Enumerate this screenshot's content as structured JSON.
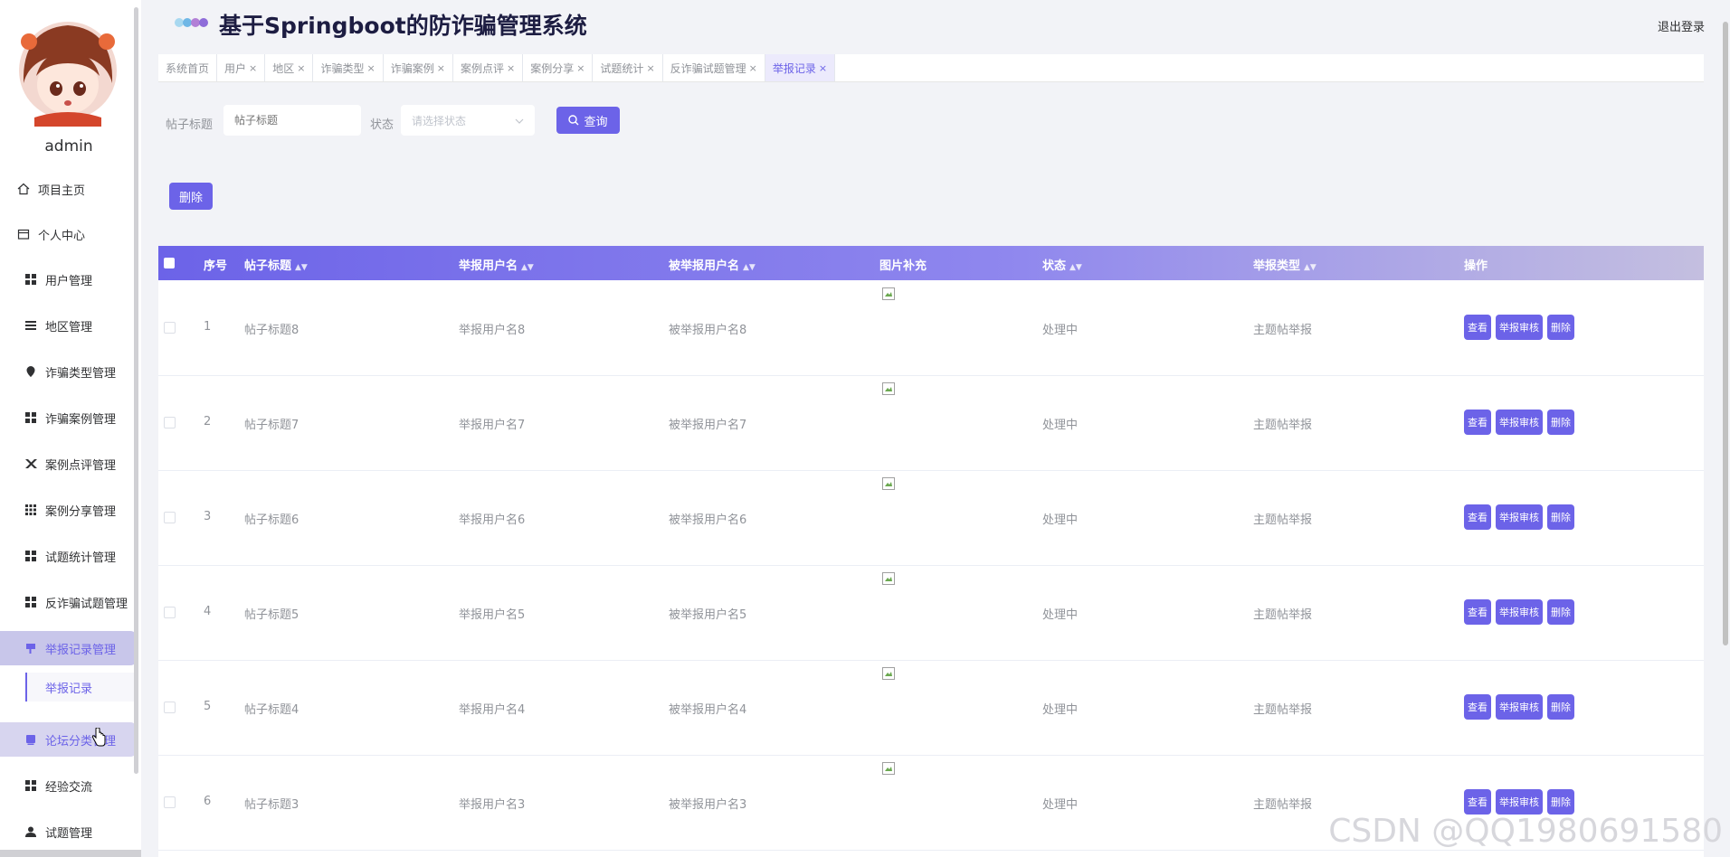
{
  "app": {
    "title": "基于Springboot的防诈骗管理系统",
    "logout": "退出登录"
  },
  "user": {
    "name": "admin"
  },
  "sidebar": {
    "items": [
      {
        "label": "项目主页",
        "icon": "home-icon"
      },
      {
        "label": "个人中心",
        "icon": "profile-icon"
      },
      {
        "label": "用户管理",
        "icon": "grid-icon"
      },
      {
        "label": "地区管理",
        "icon": "list-icon"
      },
      {
        "label": "诈骗类型管理",
        "icon": "pin-icon"
      },
      {
        "label": "诈骗案例管理",
        "icon": "grid-icon"
      },
      {
        "label": "案例点评管理",
        "icon": "swords-icon"
      },
      {
        "label": "案例分享管理",
        "icon": "grid9-icon"
      },
      {
        "label": "试题统计管理",
        "icon": "grid-icon"
      },
      {
        "label": "反诈骗试题管理",
        "icon": "grid-icon"
      },
      {
        "label": "举报记录管理",
        "icon": "flag-icon"
      },
      {
        "label": "论坛分类管理",
        "icon": "folder-icon"
      },
      {
        "label": "经验交流",
        "icon": "grid-icon"
      },
      {
        "label": "试题管理",
        "icon": "user-icon"
      }
    ],
    "sub_item": "举报记录"
  },
  "tabs": [
    {
      "label": "系统首页",
      "closable": false
    },
    {
      "label": "用户",
      "closable": true
    },
    {
      "label": "地区",
      "closable": true
    },
    {
      "label": "诈骗类型",
      "closable": true
    },
    {
      "label": "诈骗案例",
      "closable": true
    },
    {
      "label": "案例点评",
      "closable": true
    },
    {
      "label": "案例分享",
      "closable": true
    },
    {
      "label": "试题统计",
      "closable": true
    },
    {
      "label": "反诈骗试题管理",
      "closable": true
    },
    {
      "label": "举报记录",
      "closable": true,
      "active": true
    }
  ],
  "tab_close_glyph": "×",
  "search": {
    "title_label": "帖子标题",
    "title_placeholder": "帖子标题",
    "status_label": "状态",
    "status_placeholder": "请选择状态",
    "query_button": "查询"
  },
  "toolbar": {
    "delete_button": "删除"
  },
  "table": {
    "headers": {
      "index": "序号",
      "title": "帖子标题",
      "reporter": "举报用户名",
      "reported": "被举报用户名",
      "image": "图片补充",
      "status": "状态",
      "type": "举报类型",
      "actions": "操作"
    },
    "rows": [
      {
        "index": "1",
        "title": "帖子标题8",
        "reporter": "举报用户名8",
        "reported": "被举报用户名8",
        "status": "处理中",
        "type": "主题帖举报"
      },
      {
        "index": "2",
        "title": "帖子标题7",
        "reporter": "举报用户名7",
        "reported": "被举报用户名7",
        "status": "处理中",
        "type": "主题帖举报"
      },
      {
        "index": "3",
        "title": "帖子标题6",
        "reporter": "举报用户名6",
        "reported": "被举报用户名6",
        "status": "处理中",
        "type": "主题帖举报"
      },
      {
        "index": "4",
        "title": "帖子标题5",
        "reporter": "举报用户名5",
        "reported": "被举报用户名5",
        "status": "处理中",
        "type": "主题帖举报"
      },
      {
        "index": "5",
        "title": "帖子标题4",
        "reporter": "举报用户名4",
        "reported": "被举报用户名4",
        "status": "处理中",
        "type": "主题帖举报"
      },
      {
        "index": "6",
        "title": "帖子标题3",
        "reporter": "举报用户名3",
        "reported": "被举报用户名3",
        "status": "处理中",
        "type": "主题帖举报"
      }
    ],
    "row_actions": {
      "view": "查看",
      "review": "举报审核",
      "delete": "删除"
    }
  },
  "watermark": "CSDN @QQ1980691580",
  "colors": {
    "accent": "#6c63e8",
    "header_text": "#1d1d42"
  }
}
